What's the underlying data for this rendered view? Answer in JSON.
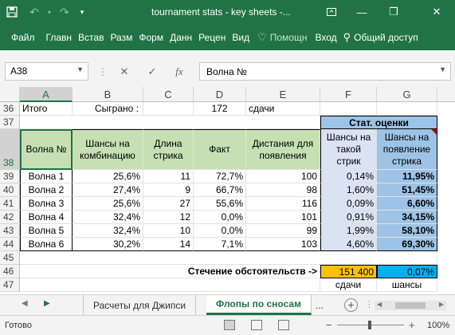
{
  "window": {
    "title": "tournament stats - key sheets -...",
    "min": "—",
    "restore": "❐",
    "close": "✕"
  },
  "ribbon": {
    "tabs": [
      "Файл",
      "Главн",
      "Встав",
      "Разм",
      "Форм",
      "Данн",
      "Рецен",
      "Вид"
    ],
    "help": "Помощн",
    "login": "Вход",
    "share": "Общий доступ"
  },
  "formula_bar": {
    "name_box": "A38",
    "formula": "Волна №"
  },
  "columns": [
    "A",
    "B",
    "C",
    "D",
    "E",
    "F",
    "G"
  ],
  "rows": {
    "r36": {
      "num": "36",
      "a": "Итого",
      "b": "Сыграно :",
      "d": "172",
      "e": "сдачи"
    },
    "r37": {
      "num": "37",
      "stat_header": "Стат. оценки"
    },
    "r38": {
      "num": "38",
      "a": "Волна №",
      "b": "Шансы на комбинацию",
      "c": "Длина стрика",
      "d": "Факт",
      "e": "Дистания для появления",
      "f": "Шансы на такой стрик",
      "g": "Шансы на появление стрика"
    },
    "data": [
      {
        "num": "39",
        "a": "Волна 1",
        "b": "25,6%",
        "c": "11",
        "d": "72,7%",
        "e": "100",
        "f": "0,14%",
        "g": "11,95%"
      },
      {
        "num": "40",
        "a": "Волна 2",
        "b": "27,4%",
        "c": "9",
        "d": "66,7%",
        "e": "98",
        "f": "1,60%",
        "g": "51,45%"
      },
      {
        "num": "41",
        "a": "Волна 3",
        "b": "25,6%",
        "c": "27",
        "d": "55,6%",
        "e": "116",
        "f": "0,09%",
        "g": "6,60%"
      },
      {
        "num": "42",
        "a": "Волна 4",
        "b": "32,4%",
        "c": "12",
        "d": "0,0%",
        "e": "101",
        "f": "0,91%",
        "g": "34,15%"
      },
      {
        "num": "43",
        "a": "Волна 5",
        "b": "32,4%",
        "c": "10",
        "d": "0,0%",
        "e": "99",
        "f": "1,99%",
        "g": "58,10%"
      },
      {
        "num": "44",
        "a": "Волна 6",
        "b": "30,2%",
        "c": "14",
        "d": "7,1%",
        "e": "103",
        "f": "4,60%",
        "g": "69,30%"
      }
    ],
    "r45": {
      "num": "45"
    },
    "r46": {
      "num": "46",
      "label": "Стечение обстоятельств ->",
      "f": "151 400",
      "g": "0,07%"
    },
    "r47": {
      "num": "47",
      "f": "сдачи",
      "g": "шансы"
    }
  },
  "sheets": {
    "tabs": [
      "Расчеты для Джипси",
      "Флопы по сносам",
      "..."
    ],
    "active_index": 1,
    "add": "+"
  },
  "status": {
    "ready": "Готово",
    "zoom": "100%",
    "zoom_minus": "−",
    "zoom_plus": "+"
  },
  "colors": {
    "excel_green": "#217346",
    "header_green": "#c6e0b4",
    "stat_light_blue": "#dae3f3",
    "stat_mid_blue": "#9dc3e6",
    "highlight_orange": "#ffc000",
    "highlight_blue": "#00b0f0"
  }
}
